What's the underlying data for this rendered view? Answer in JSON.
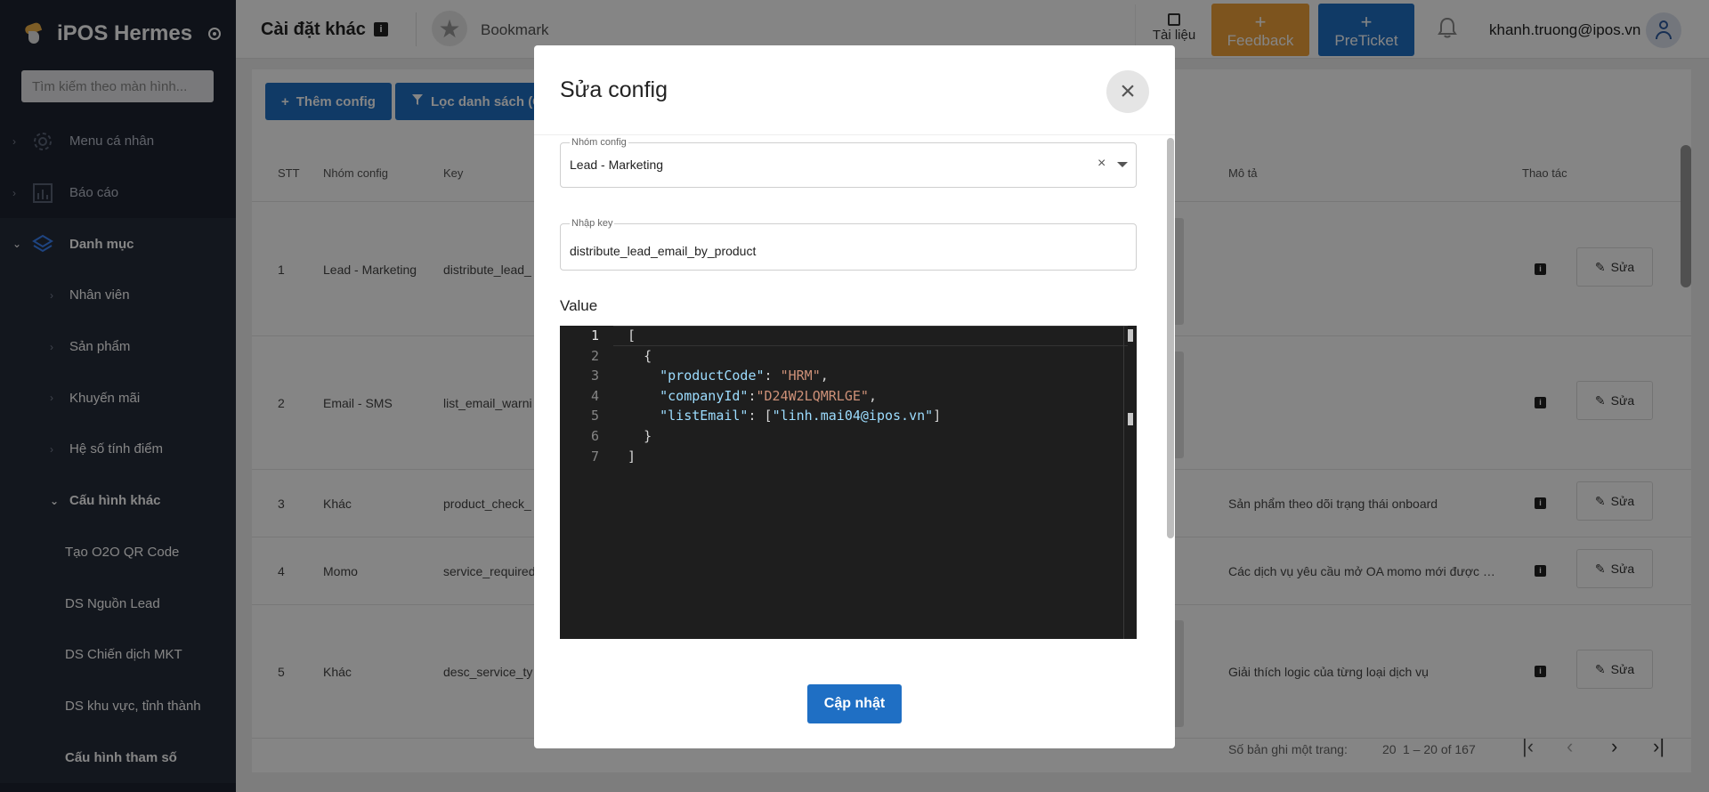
{
  "app": {
    "name": "iPOS Hermes"
  },
  "sidebar": {
    "search_placeholder": "Tìm kiếm theo màn hình...",
    "items": [
      {
        "label": "Menu cá nhân"
      },
      {
        "label": "Báo cáo"
      },
      {
        "label": "Danh mục"
      },
      {
        "label": "Nhân viên"
      },
      {
        "label": "Sản phẩm"
      },
      {
        "label": "Khuyến mãi"
      },
      {
        "label": "Hệ số tính điểm"
      },
      {
        "label": "Cấu hình khác"
      },
      {
        "label": "Tạo O2O QR Code"
      },
      {
        "label": "DS Nguồn Lead"
      },
      {
        "label": "DS Chiến dịch MKT"
      },
      {
        "label": "DS khu vực, tỉnh thành"
      },
      {
        "label": "Cấu hình tham số"
      }
    ]
  },
  "header": {
    "title": "Cài đặt khác",
    "bookmark": "Bookmark",
    "docs": "Tài liệu",
    "feedback": "Feedback",
    "preticket": "PreTicket",
    "plus": "+",
    "user_email": "khanh.truong@ipos.vn"
  },
  "toolbar": {
    "add_config": "Thêm config",
    "filter_list": "Lọc danh sách (Ct"
  },
  "table": {
    "headers": {
      "stt": "STT",
      "group": "Nhóm config",
      "key": "Key",
      "desc": "Mô tả",
      "actions": "Thao tác"
    },
    "edit_label": "Sửa",
    "rows": [
      {
        "stt": "1",
        "group": "Lead - Marketing",
        "key": "distribute_lead_",
        "desc": ""
      },
      {
        "stt": "2",
        "group": "Email - SMS",
        "key": "list_email_warni",
        "desc": ""
      },
      {
        "stt": "3",
        "group": "Khác",
        "key": "product_check_",
        "desc": "Sản phẩm theo dõi trạng thái onboard"
      },
      {
        "stt": "4",
        "group": "Momo",
        "key": "service_required",
        "desc": "Các dịch vụ yêu cầu mở OA momo mới được áp dụng"
      },
      {
        "stt": "5",
        "group": "Khác",
        "key": "desc_service_ty",
        "desc": "Giải thích logic của từng loại dịch vụ"
      }
    ]
  },
  "pagination": {
    "rows_per_page_label": "Số bản ghi một trang:",
    "rows_per_page": "20",
    "range": "1 – 20 of 167"
  },
  "modal": {
    "title": "Sửa config",
    "group_label": "Nhóm config",
    "group_value": "Lead - Marketing",
    "key_label": "Nhập key",
    "key_value": "distribute_lead_email_by_product",
    "value_label": "Value",
    "update_button": "Cập nhật",
    "code_lines": [
      "1",
      "2",
      "3",
      "4",
      "5",
      "6",
      "7"
    ],
    "code": {
      "open_bracket": "[",
      "open_brace": "{",
      "k1": "\"productCode\"",
      "v1": "\"HRM\"",
      "k2": "\"companyId\"",
      "v2": "\"D24W2LQMRLGE\"",
      "k3": "\"listEmail\"",
      "v3": "\"linh.mai04@ipos.vn\"",
      "close_brace": "}",
      "close_bracket": "]"
    }
  },
  "colors": {
    "primary": "#1f6fc4",
    "feedback": "#f0a23b",
    "sidebar_bg": "#1e2330",
    "editor_bg": "#1e1e1e"
  }
}
